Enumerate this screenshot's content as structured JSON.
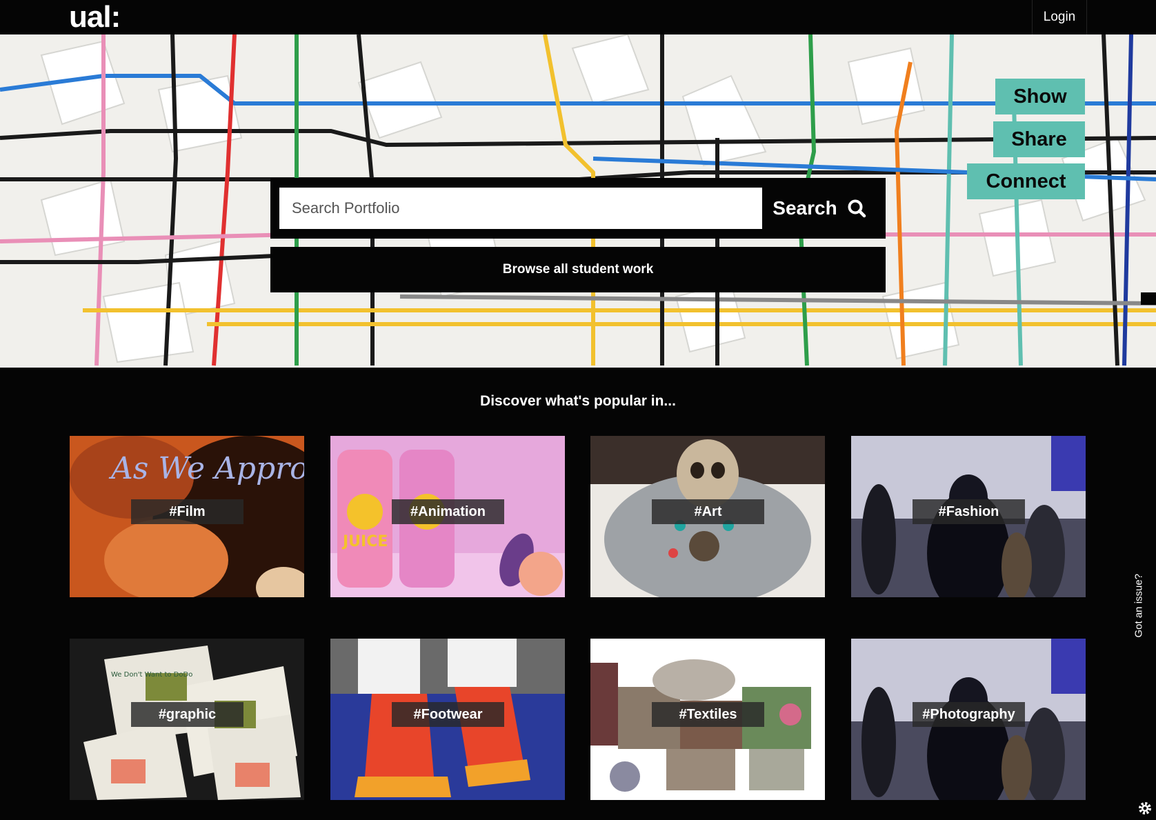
{
  "header": {
    "logo": "ual:",
    "login_label": "Login"
  },
  "hero": {
    "pills": {
      "show": "Show",
      "share": "Share",
      "connect": "Connect"
    },
    "search": {
      "placeholder": "Search Portfolio",
      "button_label": "Search"
    },
    "browse_label": "Browse all student work"
  },
  "discover": {
    "title": "Discover what's popular in...",
    "tiles": [
      {
        "tag": "#Film",
        "image_text": "As We Approach"
      },
      {
        "tag": "#Animation",
        "image_text": "JUICE"
      },
      {
        "tag": "#Art"
      },
      {
        "tag": "#Fashion"
      },
      {
        "tag": "#graphic",
        "image_text": "We Don't Want to DoDo"
      },
      {
        "tag": "#Footwear"
      },
      {
        "tag": "#Textiles"
      },
      {
        "tag": "#Photography"
      }
    ]
  },
  "side": {
    "issue_label": "Got an issue?"
  },
  "colors": {
    "accent": "#5fbfb0",
    "background": "#050505"
  },
  "icons": [
    "search-icon",
    "gear-icon"
  ]
}
